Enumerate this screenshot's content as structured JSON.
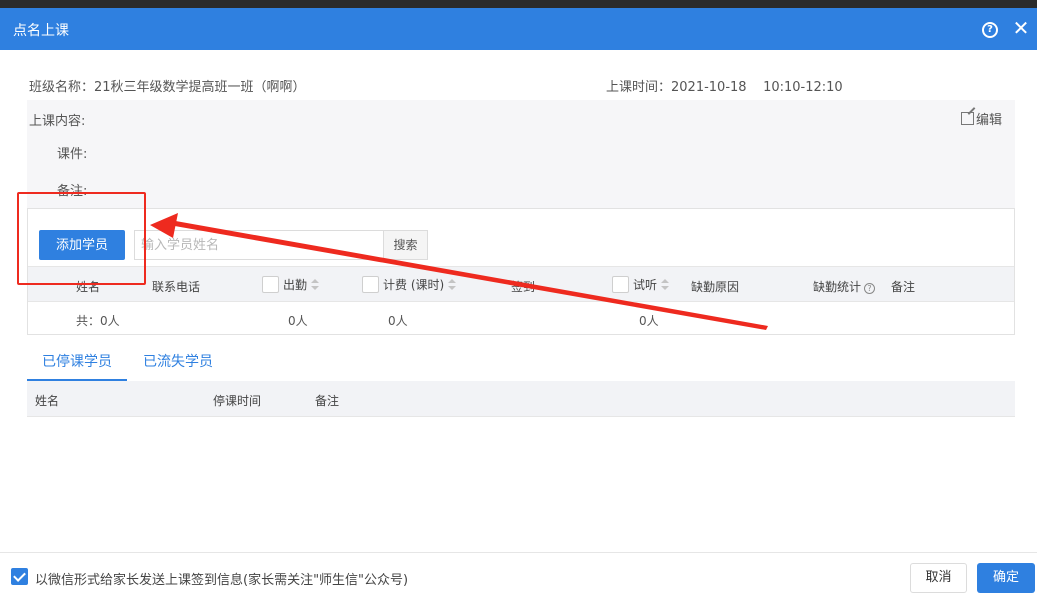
{
  "dialog": {
    "title": "点名上课"
  },
  "info": {
    "class_name": "班级名称：21秋三年级数学提高班一班（啊啊）",
    "class_time": "上课时间：2021-10-18    10:10-12:10"
  },
  "content": {
    "label": "上课内容:",
    "edit_label": "编辑",
    "courseware_label": "课件:",
    "note_label": "备注:"
  },
  "toolbar": {
    "add_student_label": "添加学员",
    "search_placeholder": "输入学员姓名",
    "search_button_label": "搜索"
  },
  "table": {
    "columns": {
      "name": "姓名",
      "phone": "联系电话",
      "attendance": "出勤",
      "billing": "计费 (课时)",
      "sign_in": "签到",
      "trial": "试听",
      "absence_reason": "缺勤原因",
      "absence_stats": "缺勤统计",
      "remark": "备注"
    },
    "summary": {
      "total": "共：0人",
      "attendance": "0人",
      "billing": "0人",
      "trial": "0人"
    }
  },
  "tabs": [
    {
      "label": "已停课学员",
      "active": true
    },
    {
      "label": "已流失学员",
      "active": false
    }
  ],
  "stopped_table": {
    "columns": {
      "name": "姓名",
      "stop_time": "停课时间",
      "remark": "备注"
    }
  },
  "footer": {
    "wechat_notify_checked": true,
    "wechat_notify_label": "以微信形式给家长发送上课签到信息(家长需关注\"师生信\"公众号)",
    "cancel_label": "取消",
    "confirm_label": "确定"
  },
  "colors": {
    "primary": "#2f80e0",
    "annotation": "#ee2a1f"
  },
  "icons": [
    "help-icon",
    "close-icon",
    "edit-icon",
    "sort-icon",
    "question-icon",
    "check-icon"
  ]
}
